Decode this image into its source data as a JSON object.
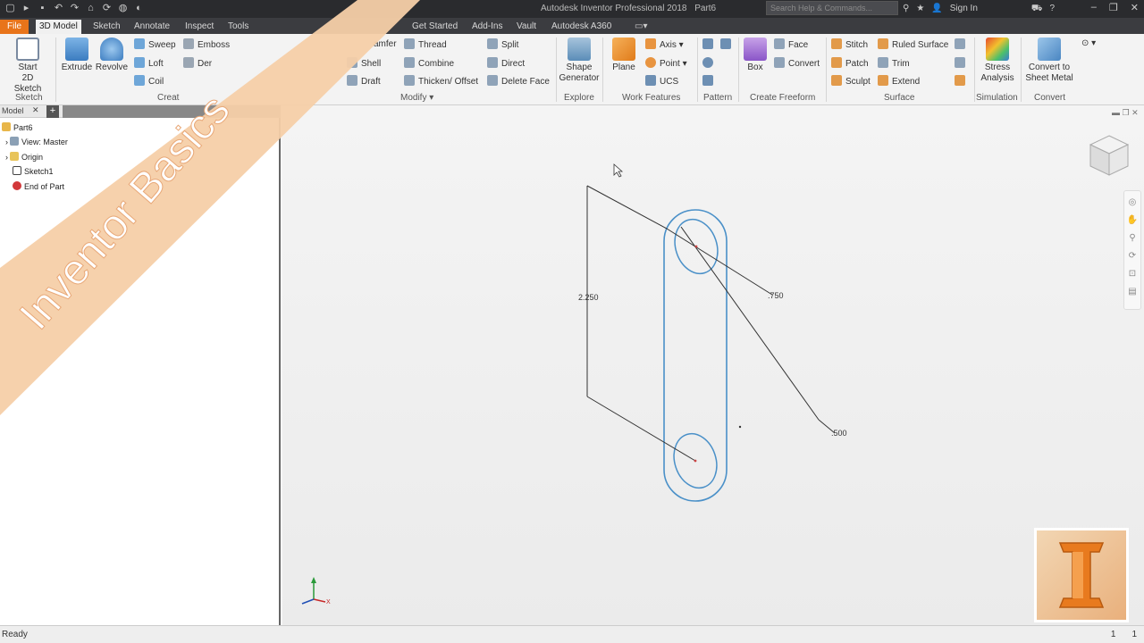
{
  "titlebar": {
    "app_title": "Autodesk Inventor Professional 2018",
    "doc_name": "Part6",
    "search_placeholder": "Search Help & Commands...",
    "sign_in": "Sign In"
  },
  "tabs": [
    {
      "label": "File"
    },
    {
      "label": "3D Model"
    },
    {
      "label": "Sketch"
    },
    {
      "label": "Annotate"
    },
    {
      "label": "Inspect"
    },
    {
      "label": "Tools"
    },
    {
      "label": "Get Started"
    },
    {
      "label": "Add-Ins"
    },
    {
      "label": "Vault"
    },
    {
      "label": "Autodesk A360"
    }
  ],
  "ribbon": {
    "sketch": {
      "start_line1": "Start",
      "start_line2": "2D Sketch",
      "group": "Sketch"
    },
    "create": {
      "extrude": "Extrude",
      "revolve": "Revolve",
      "sweep": "Sweep",
      "loft": "Loft",
      "coil": "Coil",
      "emboss": "Emboss",
      "derive": "Der",
      "group": "Creat"
    },
    "modify": {
      "chamfer": "amfer",
      "shell": "Shell",
      "draft": "Draft",
      "thread": "Thread",
      "combine": "Combine",
      "thicken": "Thicken/ Offset",
      "split": "Split",
      "direct": "Direct",
      "delete_face": "Delete Face",
      "group": "Modify"
    },
    "explore": {
      "shape_line1": "Shape",
      "shape_line2": "Generator",
      "group": "Explore"
    },
    "work": {
      "plane": "Plane",
      "axis": "Axis",
      "point": "Point",
      "ucs": "UCS",
      "group": "Work Features"
    },
    "pattern": {
      "group": "Pattern"
    },
    "freeform": {
      "box": "Box",
      "face": "Face",
      "convert": "Convert",
      "group": "Create Freeform"
    },
    "surface": {
      "stitch": "Stitch",
      "patch": "Patch",
      "sculpt": "Sculpt",
      "ruled": "Ruled Surface",
      "trim": "Trim",
      "extend": "Extend",
      "group": "Surface"
    },
    "simulation": {
      "stress_line1": "Stress",
      "stress_line2": "Analysis",
      "group": "Simulation"
    },
    "convert": {
      "sheet_line1": "Convert to",
      "sheet_line2": "Sheet Metal",
      "group": "Convert"
    }
  },
  "browser": {
    "tab_label": "Model",
    "tree": [
      {
        "label": "Part6"
      },
      {
        "label": "View: Master"
      },
      {
        "label": "Origin"
      },
      {
        "label": "Sketch1"
      },
      {
        "label": "End of Part"
      }
    ]
  },
  "sketch": {
    "dim_height": "2.250",
    "dim_diameter_top": ".750",
    "dim_diameter_bottom": ".500"
  },
  "triad": {
    "x_label": "X"
  },
  "status": {
    "text": "Ready",
    "num1": "1",
    "num2": "1"
  },
  "overlay": {
    "banner_text": "Inventor Basics",
    "logo_letter": "I"
  },
  "colors": {
    "file_tab": "#e8741a",
    "banner": "#f6cfa8",
    "sketch_profile": "#4a90c8",
    "logo_letter": "#e87a1e"
  }
}
